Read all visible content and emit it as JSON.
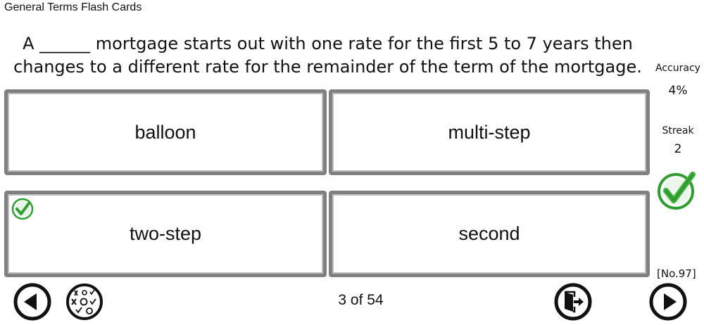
{
  "app": {
    "title": "General Terms Flash Cards"
  },
  "question": {
    "text": "A ______ mortgage starts out with one rate for the first 5 to 7 years then changes to a different rate for the remainder of the term of the mortgage."
  },
  "answers": [
    {
      "label": "balloon",
      "selected_correct": false
    },
    {
      "label": "multi-step",
      "selected_correct": false
    },
    {
      "label": "two-step",
      "selected_correct": true
    },
    {
      "label": "second",
      "selected_correct": false
    }
  ],
  "stats": {
    "accuracy_label": "Accuracy",
    "accuracy_value": "4%",
    "streak_label": "Streak",
    "streak_value": "2"
  },
  "card_number": "[No.97]",
  "pager": {
    "text": "3 of 54"
  },
  "icons": {
    "prev": "previous-arrow-icon",
    "quiz": "tic-tac-toe-quiz-icon",
    "exit": "exit-door-icon",
    "next": "next-arrow-icon",
    "check": "green-checkmark-icon"
  },
  "colors": {
    "check_green": "#3cae3c",
    "card_border": "#808080"
  }
}
